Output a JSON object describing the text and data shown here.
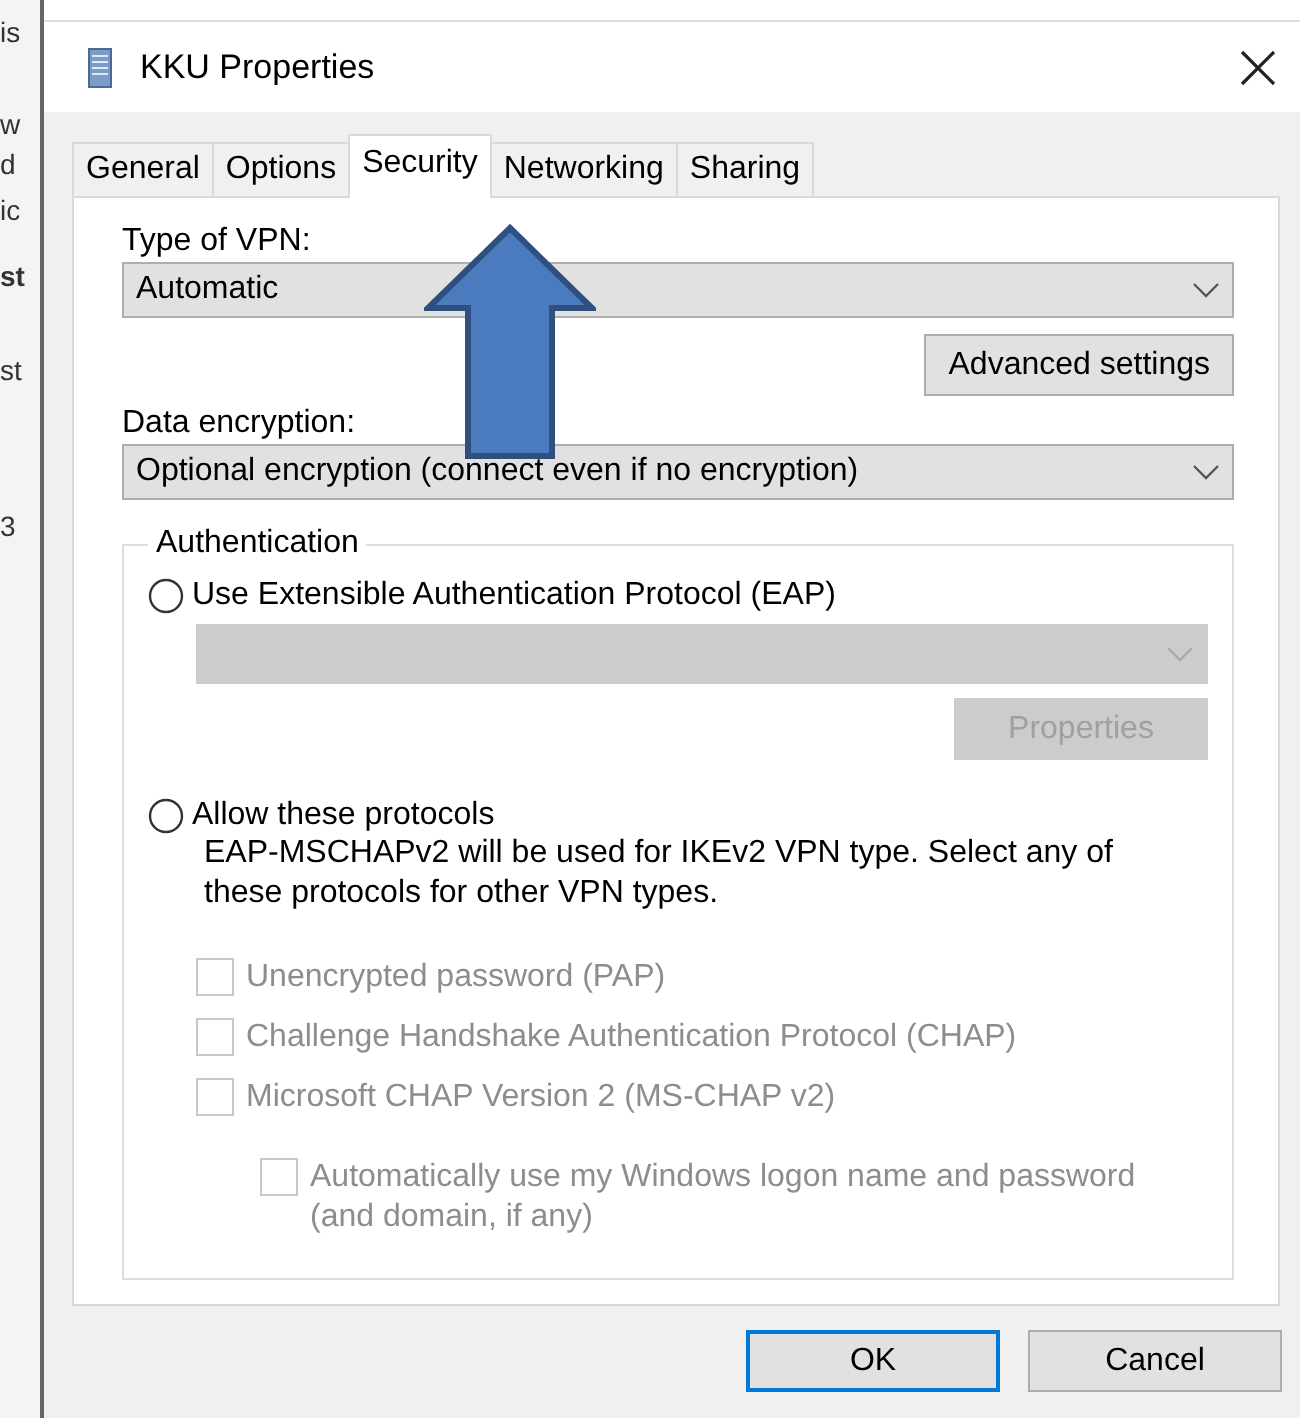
{
  "background_window": {
    "fragments": [
      "is",
      "w",
      "d",
      "ic",
      "st",
      "st",
      "3"
    ]
  },
  "window": {
    "title": "KKU Properties"
  },
  "tabs": [
    {
      "label": "General",
      "selected": false
    },
    {
      "label": "Options",
      "selected": false
    },
    {
      "label": "Security",
      "selected": true
    },
    {
      "label": "Networking",
      "selected": false
    },
    {
      "label": "Sharing",
      "selected": false
    }
  ],
  "vpn_type": {
    "label": "Type of VPN:",
    "value": "Automatic",
    "disabled": false
  },
  "advanced_button": {
    "label": "Advanced settings",
    "disabled": false
  },
  "encryption": {
    "label": "Data encryption:",
    "value": "Optional encryption (connect even if no encryption)",
    "disabled": false
  },
  "authentication": {
    "title": "Authentication",
    "options": [
      {
        "label": "Use Extensible Authentication Protocol (EAP)",
        "selected": false,
        "combo": {
          "disabled": true
        },
        "button": {
          "label": "Properties",
          "disabled": true
        }
      },
      {
        "label": "Allow these protocols",
        "selected": false,
        "description": "EAP-MSCHAPv2 will be used for IKEv2 VPN type. Select any of these protocols for other VPN types.",
        "protocols": [
          {
            "label": "Unencrypted password (PAP)",
            "checked": false,
            "disabled": true
          },
          {
            "label": "Challenge Handshake Authentication Protocol (CHAP)",
            "checked": false,
            "disabled": true
          },
          {
            "label": "Microsoft CHAP Version 2 (MS-CHAP v2)",
            "checked": false,
            "disabled": true,
            "children": [
              {
                "label": "Automatically use my Windows logon name and password (and domain, if any)",
                "checked": false,
                "disabled": true
              }
            ]
          }
        ]
      }
    ]
  },
  "buttons": [
    {
      "label": "OK",
      "default": true
    },
    {
      "label": "Cancel",
      "default": false
    }
  ],
  "annotation": {
    "kind": "arrow"
  }
}
